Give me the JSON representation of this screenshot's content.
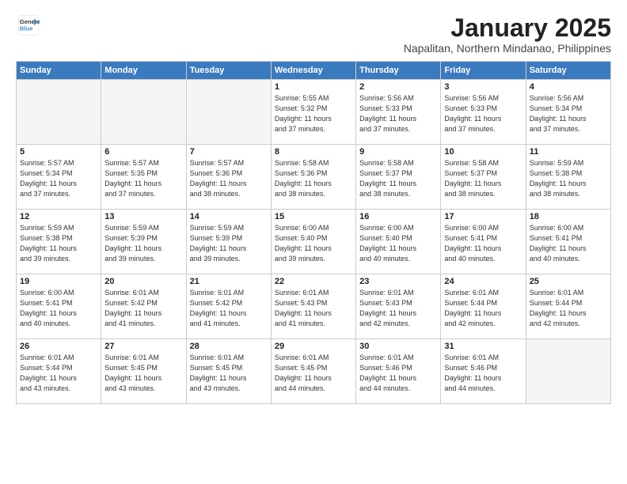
{
  "logo": {
    "line1": "General",
    "line2": "Blue"
  },
  "title": "January 2025",
  "location": "Napalitan, Northern Mindanao, Philippines",
  "weekdays": [
    "Sunday",
    "Monday",
    "Tuesday",
    "Wednesday",
    "Thursday",
    "Friday",
    "Saturday"
  ],
  "weeks": [
    [
      {
        "day": "",
        "info": ""
      },
      {
        "day": "",
        "info": ""
      },
      {
        "day": "",
        "info": ""
      },
      {
        "day": "1",
        "info": "Sunrise: 5:55 AM\nSunset: 5:32 PM\nDaylight: 11 hours\nand 37 minutes."
      },
      {
        "day": "2",
        "info": "Sunrise: 5:56 AM\nSunset: 5:33 PM\nDaylight: 11 hours\nand 37 minutes."
      },
      {
        "day": "3",
        "info": "Sunrise: 5:56 AM\nSunset: 5:33 PM\nDaylight: 11 hours\nand 37 minutes."
      },
      {
        "day": "4",
        "info": "Sunrise: 5:56 AM\nSunset: 5:34 PM\nDaylight: 11 hours\nand 37 minutes."
      }
    ],
    [
      {
        "day": "5",
        "info": "Sunrise: 5:57 AM\nSunset: 5:34 PM\nDaylight: 11 hours\nand 37 minutes."
      },
      {
        "day": "6",
        "info": "Sunrise: 5:57 AM\nSunset: 5:35 PM\nDaylight: 11 hours\nand 37 minutes."
      },
      {
        "day": "7",
        "info": "Sunrise: 5:57 AM\nSunset: 5:36 PM\nDaylight: 11 hours\nand 38 minutes."
      },
      {
        "day": "8",
        "info": "Sunrise: 5:58 AM\nSunset: 5:36 PM\nDaylight: 11 hours\nand 38 minutes."
      },
      {
        "day": "9",
        "info": "Sunrise: 5:58 AM\nSunset: 5:37 PM\nDaylight: 11 hours\nand 38 minutes."
      },
      {
        "day": "10",
        "info": "Sunrise: 5:58 AM\nSunset: 5:37 PM\nDaylight: 11 hours\nand 38 minutes."
      },
      {
        "day": "11",
        "info": "Sunrise: 5:59 AM\nSunset: 5:38 PM\nDaylight: 11 hours\nand 38 minutes."
      }
    ],
    [
      {
        "day": "12",
        "info": "Sunrise: 5:59 AM\nSunset: 5:38 PM\nDaylight: 11 hours\nand 39 minutes."
      },
      {
        "day": "13",
        "info": "Sunrise: 5:59 AM\nSunset: 5:39 PM\nDaylight: 11 hours\nand 39 minutes."
      },
      {
        "day": "14",
        "info": "Sunrise: 5:59 AM\nSunset: 5:39 PM\nDaylight: 11 hours\nand 39 minutes."
      },
      {
        "day": "15",
        "info": "Sunrise: 6:00 AM\nSunset: 5:40 PM\nDaylight: 11 hours\nand 39 minutes."
      },
      {
        "day": "16",
        "info": "Sunrise: 6:00 AM\nSunset: 5:40 PM\nDaylight: 11 hours\nand 40 minutes."
      },
      {
        "day": "17",
        "info": "Sunrise: 6:00 AM\nSunset: 5:41 PM\nDaylight: 11 hours\nand 40 minutes."
      },
      {
        "day": "18",
        "info": "Sunrise: 6:00 AM\nSunset: 5:41 PM\nDaylight: 11 hours\nand 40 minutes."
      }
    ],
    [
      {
        "day": "19",
        "info": "Sunrise: 6:00 AM\nSunset: 5:41 PM\nDaylight: 11 hours\nand 40 minutes."
      },
      {
        "day": "20",
        "info": "Sunrise: 6:01 AM\nSunset: 5:42 PM\nDaylight: 11 hours\nand 41 minutes."
      },
      {
        "day": "21",
        "info": "Sunrise: 6:01 AM\nSunset: 5:42 PM\nDaylight: 11 hours\nand 41 minutes."
      },
      {
        "day": "22",
        "info": "Sunrise: 6:01 AM\nSunset: 5:43 PM\nDaylight: 11 hours\nand 41 minutes."
      },
      {
        "day": "23",
        "info": "Sunrise: 6:01 AM\nSunset: 5:43 PM\nDaylight: 11 hours\nand 42 minutes."
      },
      {
        "day": "24",
        "info": "Sunrise: 6:01 AM\nSunset: 5:44 PM\nDaylight: 11 hours\nand 42 minutes."
      },
      {
        "day": "25",
        "info": "Sunrise: 6:01 AM\nSunset: 5:44 PM\nDaylight: 11 hours\nand 42 minutes."
      }
    ],
    [
      {
        "day": "26",
        "info": "Sunrise: 6:01 AM\nSunset: 5:44 PM\nDaylight: 11 hours\nand 43 minutes."
      },
      {
        "day": "27",
        "info": "Sunrise: 6:01 AM\nSunset: 5:45 PM\nDaylight: 11 hours\nand 43 minutes."
      },
      {
        "day": "28",
        "info": "Sunrise: 6:01 AM\nSunset: 5:45 PM\nDaylight: 11 hours\nand 43 minutes."
      },
      {
        "day": "29",
        "info": "Sunrise: 6:01 AM\nSunset: 5:45 PM\nDaylight: 11 hours\nand 44 minutes."
      },
      {
        "day": "30",
        "info": "Sunrise: 6:01 AM\nSunset: 5:46 PM\nDaylight: 11 hours\nand 44 minutes."
      },
      {
        "day": "31",
        "info": "Sunrise: 6:01 AM\nSunset: 5:46 PM\nDaylight: 11 hours\nand 44 minutes."
      },
      {
        "day": "",
        "info": ""
      }
    ]
  ]
}
